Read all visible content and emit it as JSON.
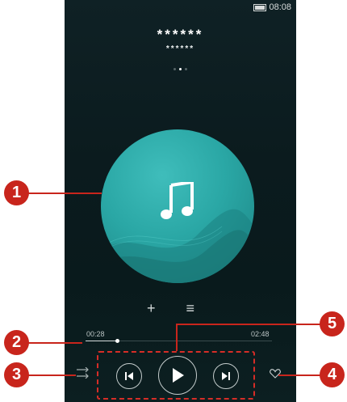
{
  "status_bar": {
    "time": "08:08"
  },
  "now_playing": {
    "title": "******",
    "subtitle": "******",
    "page_count": 3,
    "active_page": 2
  },
  "progress": {
    "elapsed": "00:28",
    "total": "02:48",
    "fraction": 0.17
  },
  "icons": {
    "add": "+",
    "playlist": "≡",
    "shuffle": "shuffle-icon",
    "previous": "previous-icon",
    "play": "play-icon",
    "next": "next-icon",
    "favorite": "heart-icon",
    "music": "music-note-icon"
  },
  "callouts": [
    "1",
    "2",
    "3",
    "4",
    "5"
  ],
  "colors": {
    "accent": "#c8251c",
    "album": "#2aa7a5",
    "background": "#0b1b1e"
  }
}
